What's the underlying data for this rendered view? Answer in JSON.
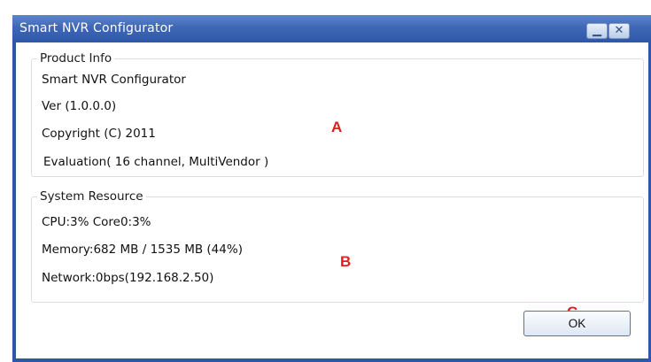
{
  "window": {
    "title": "Smart NVR Configurator",
    "minimize_glyph": "▁",
    "close_glyph": "✕"
  },
  "product_info": {
    "legend": "Product Info",
    "app_name": "Smart NVR Configurator",
    "version": "Ver (1.0.0.0)",
    "copyright": "Copyright (C) 2011",
    "license": "Evaluation( 16 channel, MultiVendor )"
  },
  "system_resource": {
    "legend": "System Resource",
    "cpu": "CPU:3%  Core0:3%",
    "memory": "Memory:682 MB / 1535 MB (44%)",
    "network": "Network:0bps(192.168.2.50)"
  },
  "annotations": {
    "a": "A",
    "b": "B",
    "c": "C",
    "color": "#e02020"
  },
  "buttons": {
    "ok": "OK"
  }
}
